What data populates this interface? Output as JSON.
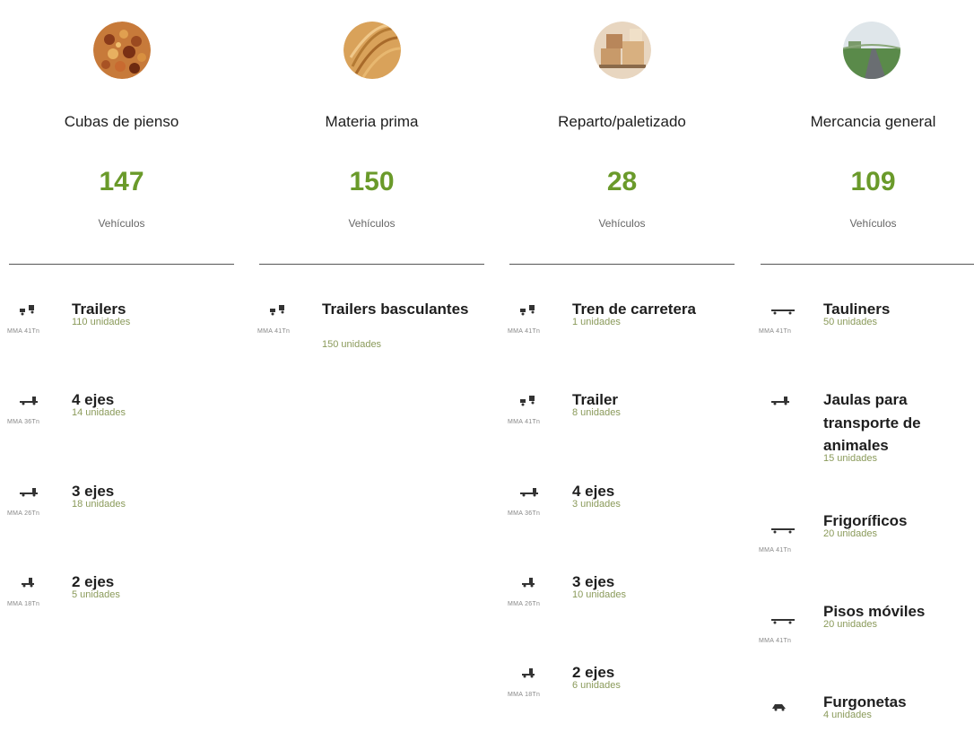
{
  "categories": [
    {
      "title": "Cubas de pienso",
      "count": "147",
      "unit": "Vehículos",
      "icon": "animal-feed-icon",
      "items": [
        {
          "label": "Trailers",
          "units": "110 unidades",
          "capacity": "MMA 41Tn",
          "icon": "trailer-truck-icon"
        },
        {
          "label": "4 ejes",
          "units": "14 unidades",
          "capacity": "MMA 36Tn",
          "icon": "rigid-truck-icon"
        },
        {
          "label": "3 ejes",
          "units": "18 unidades",
          "capacity": "MMA 26Tn",
          "icon": "rigid-truck-icon"
        },
        {
          "label": "2 ejes",
          "units": "5 unidades",
          "capacity": "MMA 18Tn",
          "icon": "small-truck-icon"
        }
      ]
    },
    {
      "title": "Materia prima",
      "count": "150",
      "unit": "Vehículos",
      "icon": "grain-icon",
      "items": [
        {
          "label": "Trailers basculantes",
          "units": "150 unidades",
          "capacity": "MMA 41Tn",
          "icon": "trailer-truck-icon"
        }
      ]
    },
    {
      "title": "Reparto/paletizado",
      "count": "28",
      "unit": "Vehículos",
      "icon": "pallet-boxes-icon",
      "items": [
        {
          "label": "Tren de carretera",
          "units": "1 unidades",
          "capacity": "MMA 41Tn",
          "icon": "trailer-truck-icon"
        },
        {
          "label": "Trailer",
          "units": "8 unidades",
          "capacity": "MMA 41Tn",
          "icon": "trailer-truck-icon"
        },
        {
          "label": "4 ejes",
          "units": "3 unidades",
          "capacity": "MMA 36Tn",
          "icon": "rigid-truck-icon"
        },
        {
          "label": "3 ejes",
          "units": "10 unidades",
          "capacity": "MMA 26Tn",
          "icon": "small-truck-icon"
        },
        {
          "label": "2 ejes",
          "units": "6 unidades",
          "capacity": "MMA 18Tn",
          "icon": "small-truck-icon"
        }
      ]
    },
    {
      "title": "Mercancia general",
      "count": "109",
      "unit": "Vehículos",
      "icon": "road-landscape-icon",
      "items": [
        {
          "label": "Tauliners",
          "units": "50 unidades",
          "capacity": "MMA 41Tn",
          "icon": "flatbed-trailer-icon"
        },
        {
          "label": "Jaulas para transporte de animales",
          "units": "15 unidades",
          "capacity": "",
          "icon": "rigid-truck-icon"
        },
        {
          "label": "Frigoríficos",
          "units": "20 unidades",
          "capacity": "MMA 41Tn",
          "icon": "flatbed-trailer-icon"
        },
        {
          "label": "Pisos móviles",
          "units": "20 unidades",
          "capacity": "MMA 41Tn",
          "icon": "flatbed-trailer-icon"
        },
        {
          "label": "Furgonetas",
          "units": "4 unidades",
          "capacity": "",
          "icon": "van-icon"
        }
      ]
    }
  ],
  "colors": {
    "accent": "#6a9a2a",
    "units_text": "#8a9a5a",
    "title_text": "#1e1e1e"
  }
}
